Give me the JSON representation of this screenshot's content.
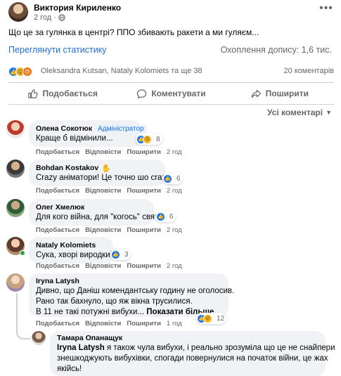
{
  "post": {
    "author": "Виктория Кириленко",
    "time": "2 год",
    "text": "Що це за гулянка в центрі? ППО збивають ракети а ми гуляєм...",
    "stats_link": "Переглянути статистику",
    "reach": "Охоплення допису: 1,6 тис.",
    "reactions_text": "Oleksandra Kutsan, Nataly Kolomiets та ще 38",
    "comments_count": "20 коментарів"
  },
  "actions": {
    "like": "Подобається",
    "comment": "Коментувати",
    "share": "Поширити"
  },
  "sort_label": "Усі коментарі",
  "comment_action_labels": {
    "like": "Подобається",
    "reply": "Відповісти",
    "share": "Поширити"
  },
  "comments": [
    {
      "name": "Олена Сокотюк",
      "badge": "Адміністратор",
      "lines": [
        "Краще б відмінили..."
      ],
      "time": "2 год",
      "reactions": "8"
    },
    {
      "name": "Bohdan Kostakov",
      "lines": [
        "Crazy аніматори! Це точно шо crazy!"
      ],
      "time": "2 год",
      "reactions": "6"
    },
    {
      "name": "Олег Хмелюк",
      "lines": [
        "Для кого війна, для \"когось\" свято"
      ],
      "time": "2 год",
      "reactions": "6"
    },
    {
      "name": "Nataly Kolomiets",
      "lines": [
        "Сука, хворі виродки!"
      ],
      "time": "2 год",
      "reactions": "3"
    },
    {
      "name": "Iryna Latysh",
      "lines": [
        "Дивно, що Даніш комендантську годину не оголосив.",
        "Рано так бахнуло, що яж вікна трусилися.",
        "В 11 не такі потужні вибухи..."
      ],
      "see_more": "Показати більше...",
      "time": "1 год",
      "reactions": "12"
    },
    {
      "name": "Тамара Опанащук",
      "mention": "Iryna Latysh",
      "lines": [
        " я також чула вибухи, і реально зрозуміла що це не снайпери",
        "знешкоджують вибухівки, спогади повернулися на початок війни, це жах",
        "якійсь!"
      ]
    }
  ],
  "colors": {
    "link": "#216fdb",
    "muted": "#65676b",
    "bubble": "#f0f2f5",
    "like": "#1877f2",
    "online": "#31a24c"
  }
}
